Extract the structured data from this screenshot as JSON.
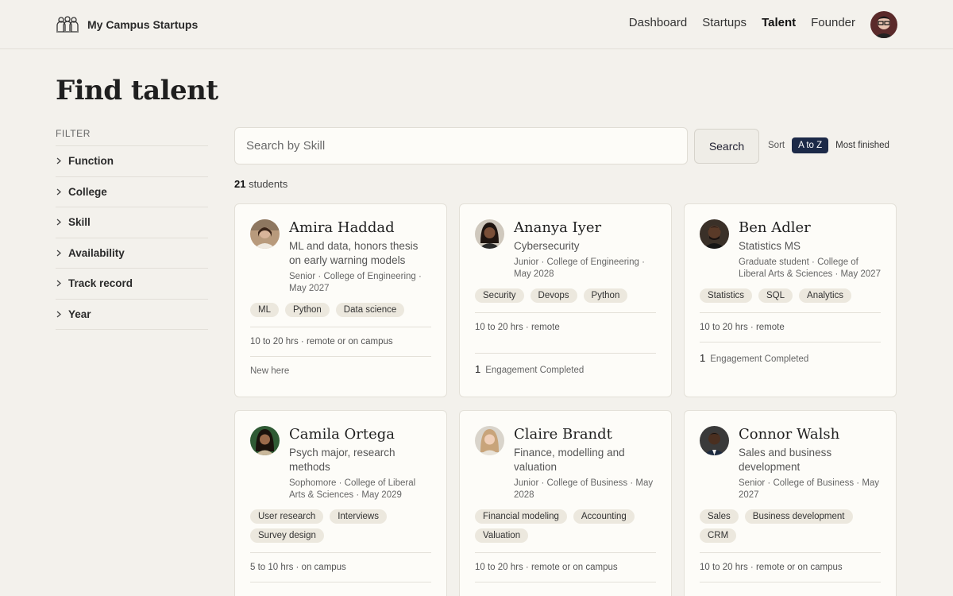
{
  "header": {
    "brand_name": "My Campus Startups",
    "nav": [
      {
        "label": "Dashboard",
        "active": false
      },
      {
        "label": "Startups",
        "active": false
      },
      {
        "label": "Talent",
        "active": true
      },
      {
        "label": "Founder",
        "active": false
      }
    ]
  },
  "page": {
    "title": "Find talent"
  },
  "filters": {
    "heading": "FILTER",
    "items": [
      "Function",
      "College",
      "Skill",
      "Availability",
      "Track record",
      "Year"
    ]
  },
  "search": {
    "placeholder": "Search by Skill",
    "value": "",
    "button_label": "Search"
  },
  "sort": {
    "label": "Sort",
    "selected": "A to Z",
    "other": "Most finished"
  },
  "results": {
    "count": "21",
    "count_label": "students"
  },
  "students": [
    {
      "name": "Amira Haddad",
      "tagline": "ML and data, honors thesis on early warning models",
      "meta": "Senior · College of Engineering · May 2027",
      "skills": [
        "ML",
        "Python",
        "Data science"
      ],
      "availability": "10 to 20 hrs · remote or on campus",
      "engagements": "",
      "status": "New here"
    },
    {
      "name": "Ananya Iyer",
      "tagline": "Cybersecurity",
      "meta": "Junior · College of Engineering · May 2028",
      "skills": [
        "Security",
        "Devops",
        "Python"
      ],
      "availability": "10 to 20 hrs · remote",
      "engagements": "1",
      "status": "Engagement Completed"
    },
    {
      "name": "Ben Adler",
      "tagline": "Statistics MS",
      "meta": "Graduate student · College of Liberal Arts & Sciences · May 2027",
      "skills": [
        "Statistics",
        "SQL",
        "Analytics"
      ],
      "availability": "10 to 20 hrs · remote",
      "engagements": "1",
      "status": "Engagement Completed"
    },
    {
      "name": "Camila Ortega",
      "tagline": "Psych major, research methods",
      "meta": "Sophomore · College of Liberal Arts & Sciences · May 2029",
      "skills": [
        "User research",
        "Interviews",
        "Survey design"
      ],
      "availability": "5 to 10 hrs · on campus",
      "engagements": "",
      "status": ""
    },
    {
      "name": "Claire Brandt",
      "tagline": "Finance, modelling and valuation",
      "meta": "Junior · College of Business · May 2028",
      "skills": [
        "Financial modeling",
        "Accounting",
        "Valuation"
      ],
      "availability": "10 to 20 hrs · remote or on campus",
      "engagements": "",
      "status": ""
    },
    {
      "name": "Connor Walsh",
      "tagline": "Sales and business development",
      "meta": "Senior · College of Business · May 2027",
      "skills": [
        "Sales",
        "Business development",
        "CRM"
      ],
      "availability": "10 to 20 hrs · remote or on campus",
      "engagements": "",
      "status": ""
    }
  ]
}
